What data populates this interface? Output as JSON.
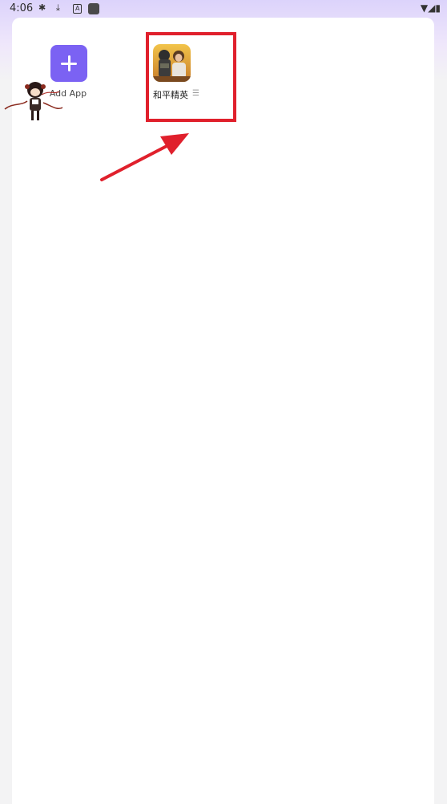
{
  "status_bar": {
    "time": "4:06",
    "icons": [
      "bug-icon",
      "download-icon",
      "a-icon",
      "app-square-icon",
      "wifi-icon",
      "signal-icon",
      "battery-icon"
    ]
  },
  "launcher": {
    "add_app": {
      "label": "Add App",
      "icon": "plus-icon",
      "color": "#7b62f3"
    },
    "apps": [
      {
        "label": "和平精英",
        "icon": "game-app-icon"
      }
    ]
  },
  "annotation": {
    "box_color": "#e0202c",
    "arrow_color": "#e0202c"
  }
}
